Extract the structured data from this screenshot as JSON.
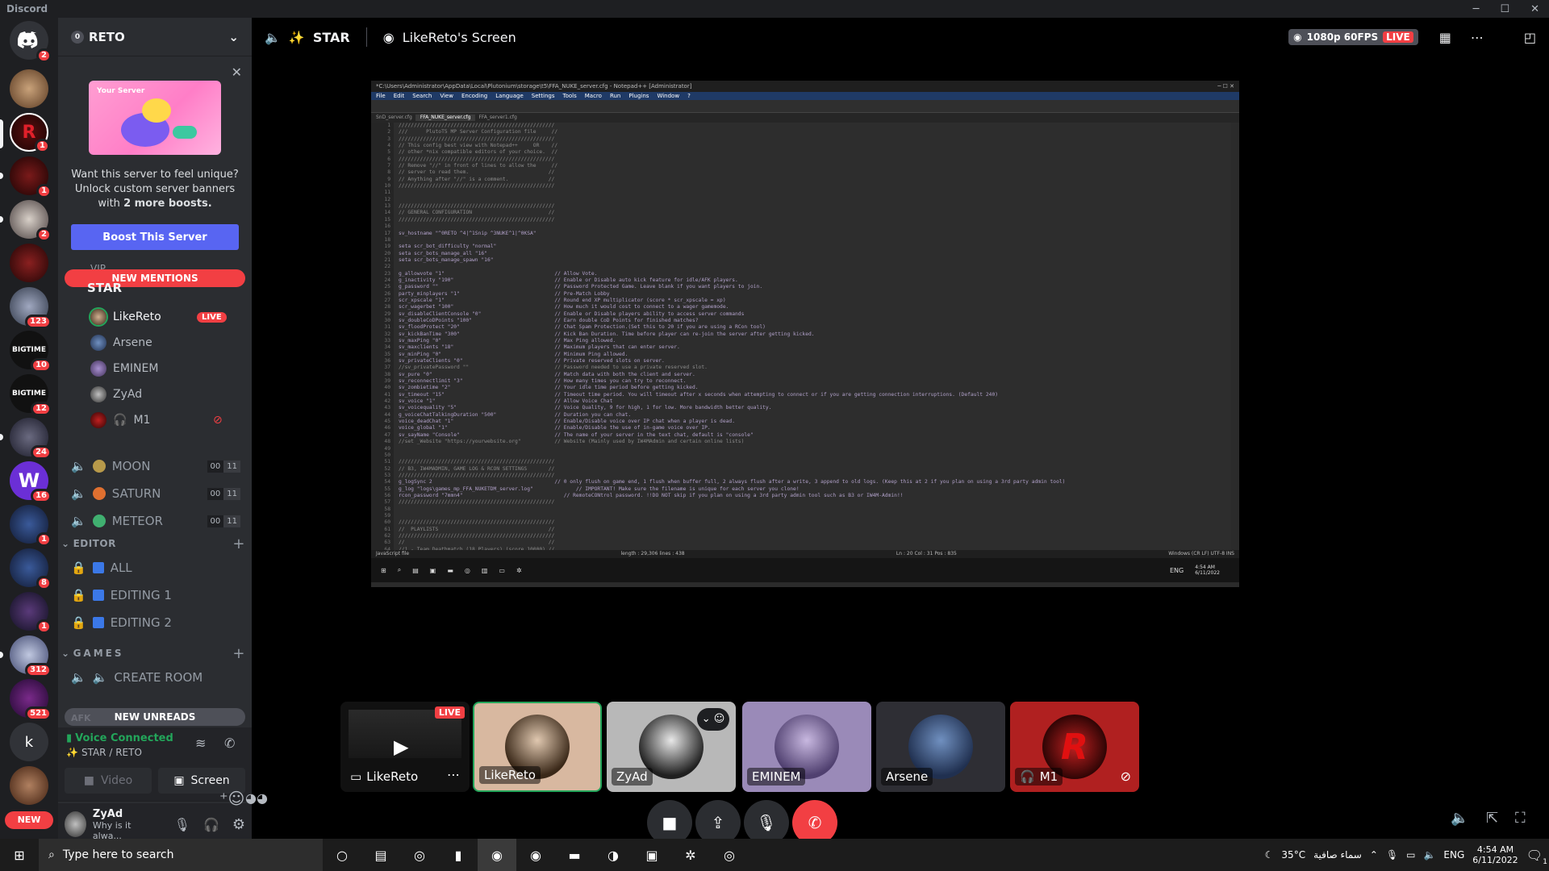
{
  "window": {
    "title": "Discord",
    "controls": [
      "─",
      "☐",
      "✕"
    ]
  },
  "rail": {
    "badges": [
      "2",
      "1",
      "1",
      "2",
      "123",
      "10",
      "12",
      "24",
      "16",
      "1",
      "8",
      "1",
      "312",
      "521"
    ],
    "dm_letter": "k",
    "new_label": "NEW",
    "bigtime_label": "BIGTIME"
  },
  "server": {
    "name": "RETO",
    "boost_count": "0"
  },
  "boost": {
    "banner_label": "Your Server",
    "text": "Want this server to feel unique? Unlock custom server banners with",
    "text_bold": "2 more boosts.",
    "button": "Boost This Server"
  },
  "pills": {
    "new_mentions": "NEW MENTIONS",
    "new_unreads": "NEW UNREADS"
  },
  "voice_channel": {
    "name": "STAR",
    "partial_above": "VIP",
    "users": [
      {
        "name": "LikeReto",
        "badge": "LIVE"
      },
      {
        "name": "Arsene"
      },
      {
        "name": "EMINEM"
      },
      {
        "name": "ZyAd"
      },
      {
        "name": "M1",
        "prefix": "🎧"
      }
    ]
  },
  "channels": [
    {
      "name": "MOON",
      "a": "00",
      "b": "11"
    },
    {
      "name": "SATURN",
      "a": "00",
      "b": "11"
    },
    {
      "name": "METEOR",
      "a": "00",
      "b": "11"
    }
  ],
  "editor_category": {
    "name": "EDITOR",
    "channels": [
      "ALL",
      "EDITING 1",
      "EDITING 2"
    ]
  },
  "games_category": {
    "name": "GAMES",
    "channels": [
      "CREATE ROOM"
    ]
  },
  "afk_partial": "AFK",
  "voice_status": {
    "title": "Voice Connected",
    "sub": "STAR / RETO",
    "video": "Video",
    "screen": "Screen"
  },
  "user": {
    "name": "ZyAd",
    "status": "Why is it alwa..."
  },
  "header": {
    "channel": "STAR",
    "stream_title": "LikeReto's Screen",
    "quality": "1080p 60FPS",
    "live": "LIVE"
  },
  "stream": {
    "npp_title": "*C:\\Users\\Administrator\\AppData\\Local\\Plutonium\\storage\\t5\\FFA_NUKE_server.cfg - Notepad++ [Administrator]",
    "menu": [
      "File",
      "Edit",
      "Search",
      "View",
      "Encoding",
      "Language",
      "Settings",
      "Tools",
      "Macro",
      "Run",
      "Plugins",
      "Window",
      "?"
    ],
    "tabs": [
      "SnD_server.cfg",
      "FFA_NUKE_server.cfg",
      "FFA_server1.cfg"
    ],
    "status_left": "JavaScript file",
    "status_mid": "length : 29,306    lines : 438",
    "status_pos": "Ln : 20    Col : 31    Pos : 835",
    "status_right": "Windows (CR LF)    UTF-8    INS",
    "clock": "4:54 AM\n6/11/2022",
    "lang": "ENG",
    "code_lines": [
      "///////////////////////////////////////////////////",
      "///      PlutoT5 MP Server Configuration file     //",
      "///////////////////////////////////////////////////",
      "// This config best view with Notepad++     OR    //",
      "// other *nix compatible editors of your choice.  //",
      "///////////////////////////////////////////////////",
      "// Remove \"//\" in front of lines to allow the     //",
      "// server to read them.                          //",
      "// Anything after \"//\" is a comment.             //",
      "///////////////////////////////////////////////////",
      "",
      "",
      "///////////////////////////////////////////////////",
      "// GENERAL CONFIGURATION                         //",
      "///////////////////////////////////////////////////",
      "",
      "sv_hostname \"^0RETO ^4|^1Snip ^3NUKE^1|^0KSA\"",
      "",
      "seta scr_bot_difficulty \"normal\"",
      "seta scr_bots_manage_all \"16\"",
      "seta scr_bots_manage_spawn \"16\"",
      "",
      "g_allowvote \"1\"                                    // Allow Vote.",
      "g_inactivity \"190\"                                 // Enable or Disable auto kick feature for idle/AFK players.",
      "g_password \"\"                                      // Password Protected Game. Leave blank if you want players to join.",
      "party_minplayers \"1\"                               // Pre-Match Lobby",
      "scr_xpscale \"1\"                                    // Round end XP multiplicator (score * scr_xpscale = xp)",
      "scr_wagerbet \"100\"                                 // How much it would cost to connect to a wager gamemode.",
      "sv_disableClientConsole \"0\"                        // Enable or Disable players ability to access server commands",
      "sv_doubleCoDPoints \"100\"                           // Earn double CoD Points for finished matches?",
      "sv_floodProtect \"20\"                               // Chat Spam Protection.(Set this to 20 if you are using a RCon tool)",
      "sv_kickBanTime \"300\"                               // Kick Ban Duration. Time before player can re-join the server after getting kicked.",
      "sv_maxPing \"0\"                                     // Max Ping allowed.",
      "sv_maxclients \"18\"                                 // Maximum players that can enter server.",
      "sv_minPing \"0\"                                     // Minimum Ping allowed.",
      "sv_privateClients \"0\"                              // Private reserved slots on server.",
      "//sv_privatePassword \"\"                            // Password needed to use a private reserved slot.",
      "sv_pure \"0\"                                        // Match data with both the client and server.",
      "sv_reconnectlimit \"3\"                              // How many times you can try to reconnect.",
      "sv_zombietime \"2\"                                  // Your idle time period before getting kicked.",
      "sv_timeout \"15\"                                    // Timeout time period. You will timeout after x seconds when attempting to connect or if you are getting connection interruptions. (Default 240)",
      "sv_voice \"1\"                                       // Allow Voice Chat",
      "sv_voicequality \"5\"                                // Voice Quality, 9 for high, 1 for low. More bandwidth better quality.",
      "g_voiceChatTalkingDuration \"500\"                   // Duration you can chat.",
      "voice_deadChat \"1\"                                 // Enable/Disable voice over IP chat when a player is dead.",
      "voice_global \"1\"                                   // Enable/Disable the use of in-game voice over IP.",
      "sv_sayName \"Console\"                               // The name of your server in the text chat, default is \"console\"",
      "//set _Website \"https://yourwebsite.org\"           // Website (Mainly used by IW4MAdmin and certain online lists)",
      "",
      "",
      "///////////////////////////////////////////////////",
      "// B3, IW4MADMIN, GAME LOG & RCON SETTINGS       //",
      "///////////////////////////////////////////////////",
      "g_logSync 2                                        // 0 only flush on game end, 1 flush when buffer full, 2 always flush after a write, 3 append to old logs. (Keep this at 2 if you plan on using a 3rd party admin tool)",
      "g_log \"logs\\games_mp_FFA_NUKETDM_server.log\"              // IMPORTANT! Make sure the filename is unique for each server you clone!",
      "rcon_password \"7mmn4\"                                 // RemoteCONtrol password. !!DO NOT skip if you plan on using a 3rd party admin tool such as B3 or IW4M-Admin!!",
      "///////////////////////////////////////////////////",
      "",
      "",
      "///////////////////////////////////////////////////",
      "//  PLAYLISTS                                    //",
      "///////////////////////////////////////////////////",
      "//                                               //",
      "//1 - Team Deathmatch (18 Players) (score 10000) //"
    ]
  },
  "tiles": [
    {
      "name": "LikeReto",
      "live": "LIVE"
    },
    {
      "name": "LikeReto"
    },
    {
      "name": "ZyAd"
    },
    {
      "name": "EMINEM"
    },
    {
      "name": "Arsene"
    },
    {
      "name": "M1",
      "prefix": "🎧"
    }
  ],
  "taskbar": {
    "search_placeholder": "Type here to search",
    "weather": "35°C",
    "weather_text": "سماء صافية",
    "lang": "ENG",
    "time": "4:54 AM",
    "date": "6/11/2022",
    "notif": "1"
  },
  "colors": {
    "accent": "#5865f2",
    "danger": "#f23f43",
    "online": "#23a55a"
  }
}
